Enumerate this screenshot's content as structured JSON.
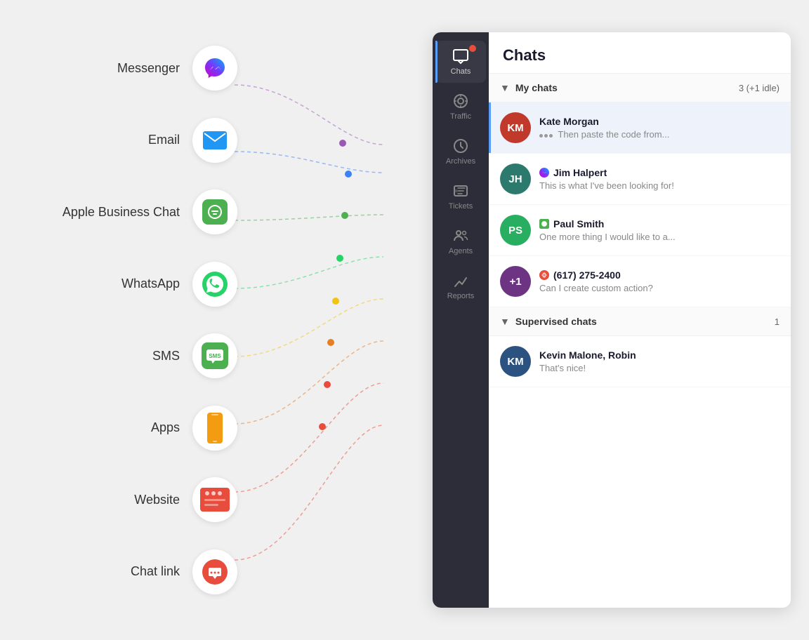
{
  "channels": [
    {
      "id": "messenger",
      "label": "Messenger",
      "color": "#0084ff",
      "dot_color": "#9b59b6",
      "icon_type": "messenger"
    },
    {
      "id": "email",
      "label": "Email",
      "color": "#3b82f6",
      "dot_color": "#3b82f6",
      "icon_type": "email"
    },
    {
      "id": "apple",
      "label": "Apple Business Chat",
      "color": "#4CAF50",
      "dot_color": "#4CAF50",
      "icon_type": "apple"
    },
    {
      "id": "whatsapp",
      "label": "WhatsApp",
      "color": "#25D366",
      "dot_color": "#25D366",
      "icon_type": "whatsapp"
    },
    {
      "id": "sms",
      "label": "SMS",
      "color": "#4CAF50",
      "dot_color": "#f1c40f",
      "icon_type": "sms"
    },
    {
      "id": "apps",
      "label": "Apps",
      "color": "#f39c12",
      "dot_color": "#e67e22",
      "icon_type": "apps"
    },
    {
      "id": "website",
      "label": "Website",
      "color": "#e74c3c",
      "dot_color": "#e74c3c",
      "icon_type": "website"
    },
    {
      "id": "chatlink",
      "label": "Chat link",
      "color": "#e74c3c",
      "dot_color": "#e74c3c",
      "icon_type": "chatlink"
    }
  ],
  "nav": {
    "items": [
      {
        "id": "chats",
        "label": "Chats",
        "active": true,
        "badge": true
      },
      {
        "id": "traffic",
        "label": "Traffic",
        "active": false,
        "badge": false
      },
      {
        "id": "archives",
        "label": "Archives",
        "active": false,
        "badge": false
      },
      {
        "id": "tickets",
        "label": "Tickets",
        "active": false,
        "badge": false
      },
      {
        "id": "agents",
        "label": "Agents",
        "active": false,
        "badge": false
      },
      {
        "id": "reports",
        "label": "Reports",
        "active": false,
        "badge": false
      }
    ]
  },
  "chat_panel": {
    "title": "Chats",
    "sections": [
      {
        "id": "my-chats",
        "title": "My chats",
        "count": "3 (+1 idle)",
        "chats": [
          {
            "id": "kate-morgan",
            "name": "Kate Morgan",
            "initials": "KM",
            "avatar_color": "#c0392b",
            "preview": "Then paste the code from...",
            "typing": true,
            "source": null,
            "active": true
          },
          {
            "id": "jim-halpert",
            "name": "Jim Halpert",
            "initials": "JH",
            "avatar_color": "#2c7a6e",
            "preview": "This is what I've been looking for!",
            "typing": false,
            "source": "messenger",
            "active": false
          },
          {
            "id": "paul-smith",
            "name": "Paul Smith",
            "initials": "PS",
            "avatar_color": "#27ae60",
            "preview": "One more thing I would like to a...",
            "typing": false,
            "source": "apple",
            "active": false
          },
          {
            "id": "phone",
            "name": "(617) 275-2400",
            "initials": "+1",
            "avatar_color": "#6c3483",
            "preview": "Can I create custom action?",
            "typing": false,
            "source": "phone",
            "active": false
          }
        ]
      },
      {
        "id": "supervised-chats",
        "title": "Supervised chats",
        "count": "1",
        "chats": [
          {
            "id": "kevin-malone",
            "name": "Kevin Malone, Robin",
            "initials": "KM",
            "avatar_color": "#2c5282",
            "preview": "That's nice!",
            "typing": false,
            "source": null,
            "active": false
          }
        ]
      }
    ]
  }
}
